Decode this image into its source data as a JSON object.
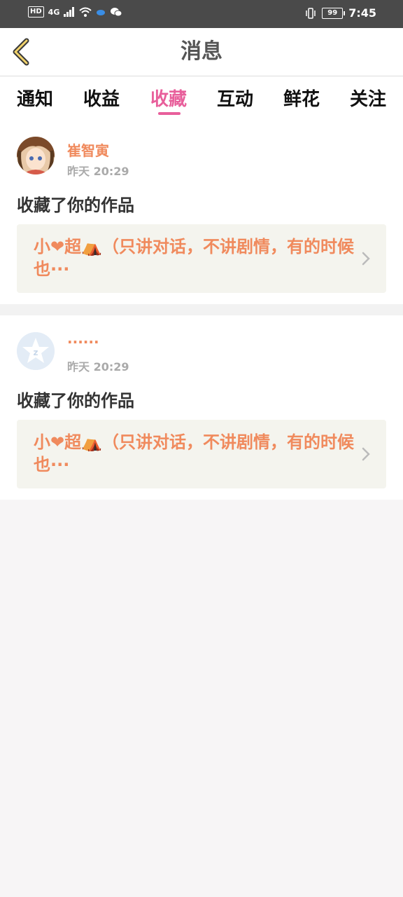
{
  "status_bar": {
    "hd": "HD",
    "network": "4G",
    "battery": "99",
    "time": "7:45"
  },
  "nav": {
    "title": "消息"
  },
  "tabs": [
    {
      "label": "通知",
      "active": false
    },
    {
      "label": "收益",
      "active": false
    },
    {
      "label": "收藏",
      "active": true
    },
    {
      "label": "互动",
      "active": false
    },
    {
      "label": "鲜花",
      "active": false
    },
    {
      "label": "关注",
      "active": false
    }
  ],
  "items": [
    {
      "username": "崔智寅",
      "time": "昨天 20:29",
      "action": "收藏了你的作品",
      "work_title": "小❤超⛺（只讲对话，不讲剧情，有的时候也···"
    },
    {
      "username": "······",
      "time": "昨天 20:29",
      "action": "收藏了你的作品",
      "work_title": "小❤超⛺（只讲对话，不讲剧情，有的时候也···"
    }
  ],
  "colors": {
    "accent": "#e85f9b",
    "username": "#f08a5d",
    "work_title": "#f08a5d"
  }
}
